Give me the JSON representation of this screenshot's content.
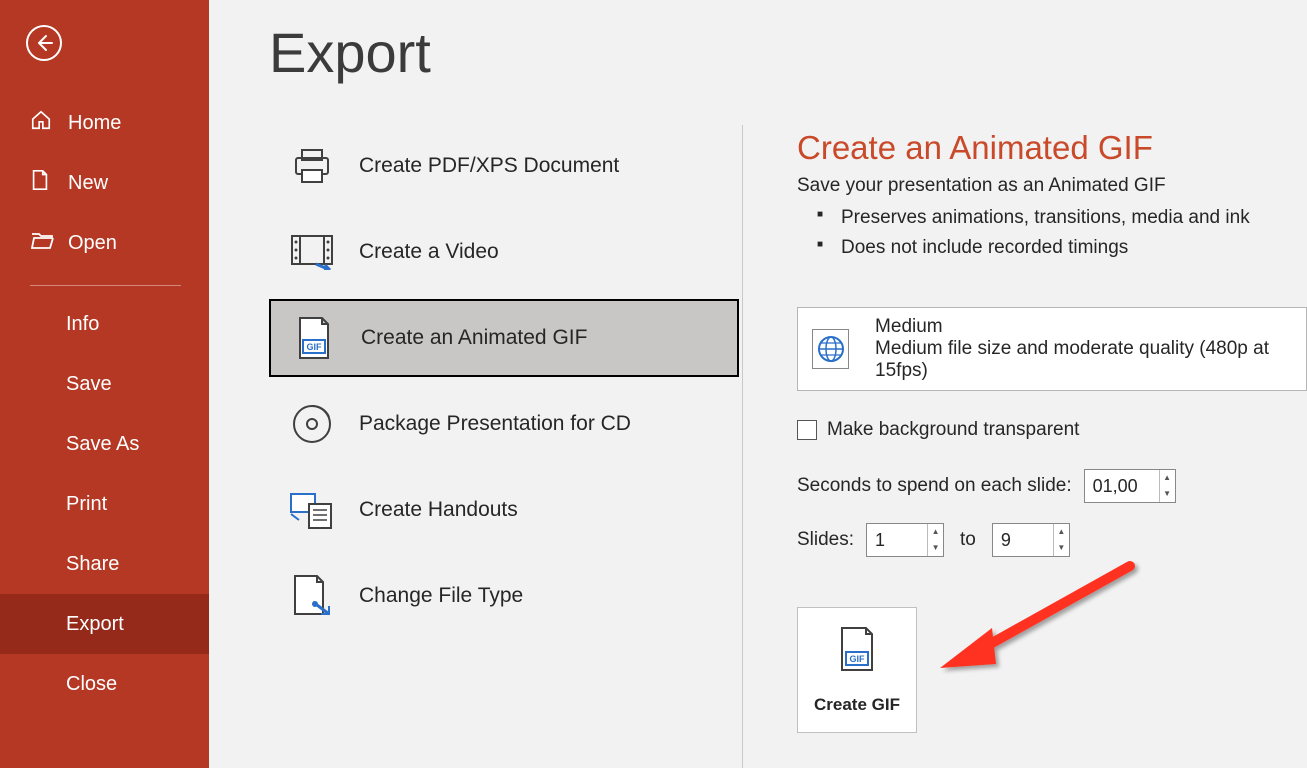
{
  "sidebar": {
    "home": "Home",
    "new": "New",
    "open": "Open",
    "info": "Info",
    "save": "Save",
    "save_as": "Save As",
    "print": "Print",
    "share": "Share",
    "export": "Export",
    "close": "Close"
  },
  "page": {
    "title": "Export"
  },
  "options": {
    "pdf": "Create PDF/XPS Document",
    "video": "Create a Video",
    "gif": "Create an Animated GIF",
    "package": "Package Presentation for CD",
    "handouts": "Create Handouts",
    "filetype": "Change File Type"
  },
  "details": {
    "title": "Create an Animated GIF",
    "subtitle": "Save your presentation as an Animated GIF",
    "bullet1": "Preserves animations, transitions, media and ink",
    "bullet2": "Does not include recorded timings",
    "quality_title": "Medium",
    "quality_desc": "Medium file size and moderate quality (480p at 15fps)",
    "transparent_label": "Make background transparent",
    "seconds_label": "Seconds to spend on each slide:",
    "seconds_value": "01,00",
    "slides_label": "Slides:",
    "slides_from": "1",
    "slides_to_label": "to",
    "slides_to": "9",
    "create_button": "Create GIF"
  }
}
